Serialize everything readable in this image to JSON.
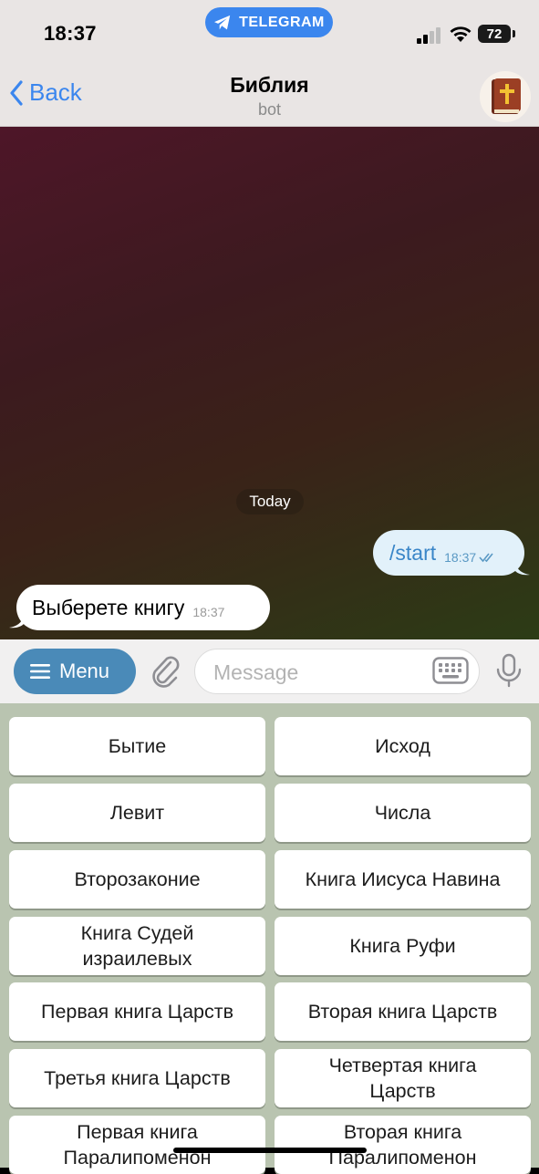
{
  "status": {
    "time": "18:37",
    "app_pill": "TELEGRAM",
    "battery": "72"
  },
  "header": {
    "back_label": "Back",
    "title": "Библия",
    "subtitle": "bot"
  },
  "chat": {
    "date_label": "Today",
    "messages": [
      {
        "direction": "out",
        "text": "/start",
        "time": "18:37",
        "status_icon": "double-check-icon"
      },
      {
        "direction": "in",
        "text": "Выберете книгу",
        "time": "18:37"
      }
    ]
  },
  "input": {
    "menu_label": "Menu",
    "placeholder": "Message"
  },
  "keyboard": {
    "buttons": [
      "Бытие",
      "Исход",
      "Левит",
      "Числа",
      "Второзаконие",
      "Книга Иисуса Навина",
      "Книга Судей израилевых",
      "Книга Руфи",
      "Первая книга Царств",
      "Вторая книга Царств",
      "Третья книга Царств",
      "Четвертая книга Царств",
      "Первая книга Паралипоменон",
      "Вторая книга Паралипоменон"
    ]
  },
  "colors": {
    "accent": "#3b86ee",
    "menu_button": "#4a8ab8",
    "outgoing_bubble": "#e2f1fa",
    "keyboard_bg": "#b9c4b0"
  }
}
